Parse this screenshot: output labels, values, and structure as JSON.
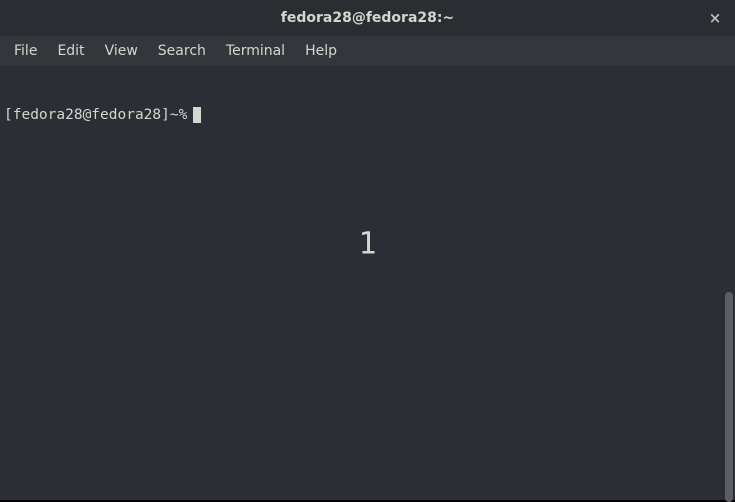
{
  "titlebar": {
    "title": "fedora28@fedora28:~",
    "close_label": "×"
  },
  "menubar": {
    "items": [
      {
        "label": "File"
      },
      {
        "label": "Edit"
      },
      {
        "label": "View"
      },
      {
        "label": "Search"
      },
      {
        "label": "Terminal"
      },
      {
        "label": "Help"
      }
    ]
  },
  "terminal": {
    "prompt": "[fedora28@fedora28]~%"
  },
  "overlay": {
    "number": "1"
  }
}
